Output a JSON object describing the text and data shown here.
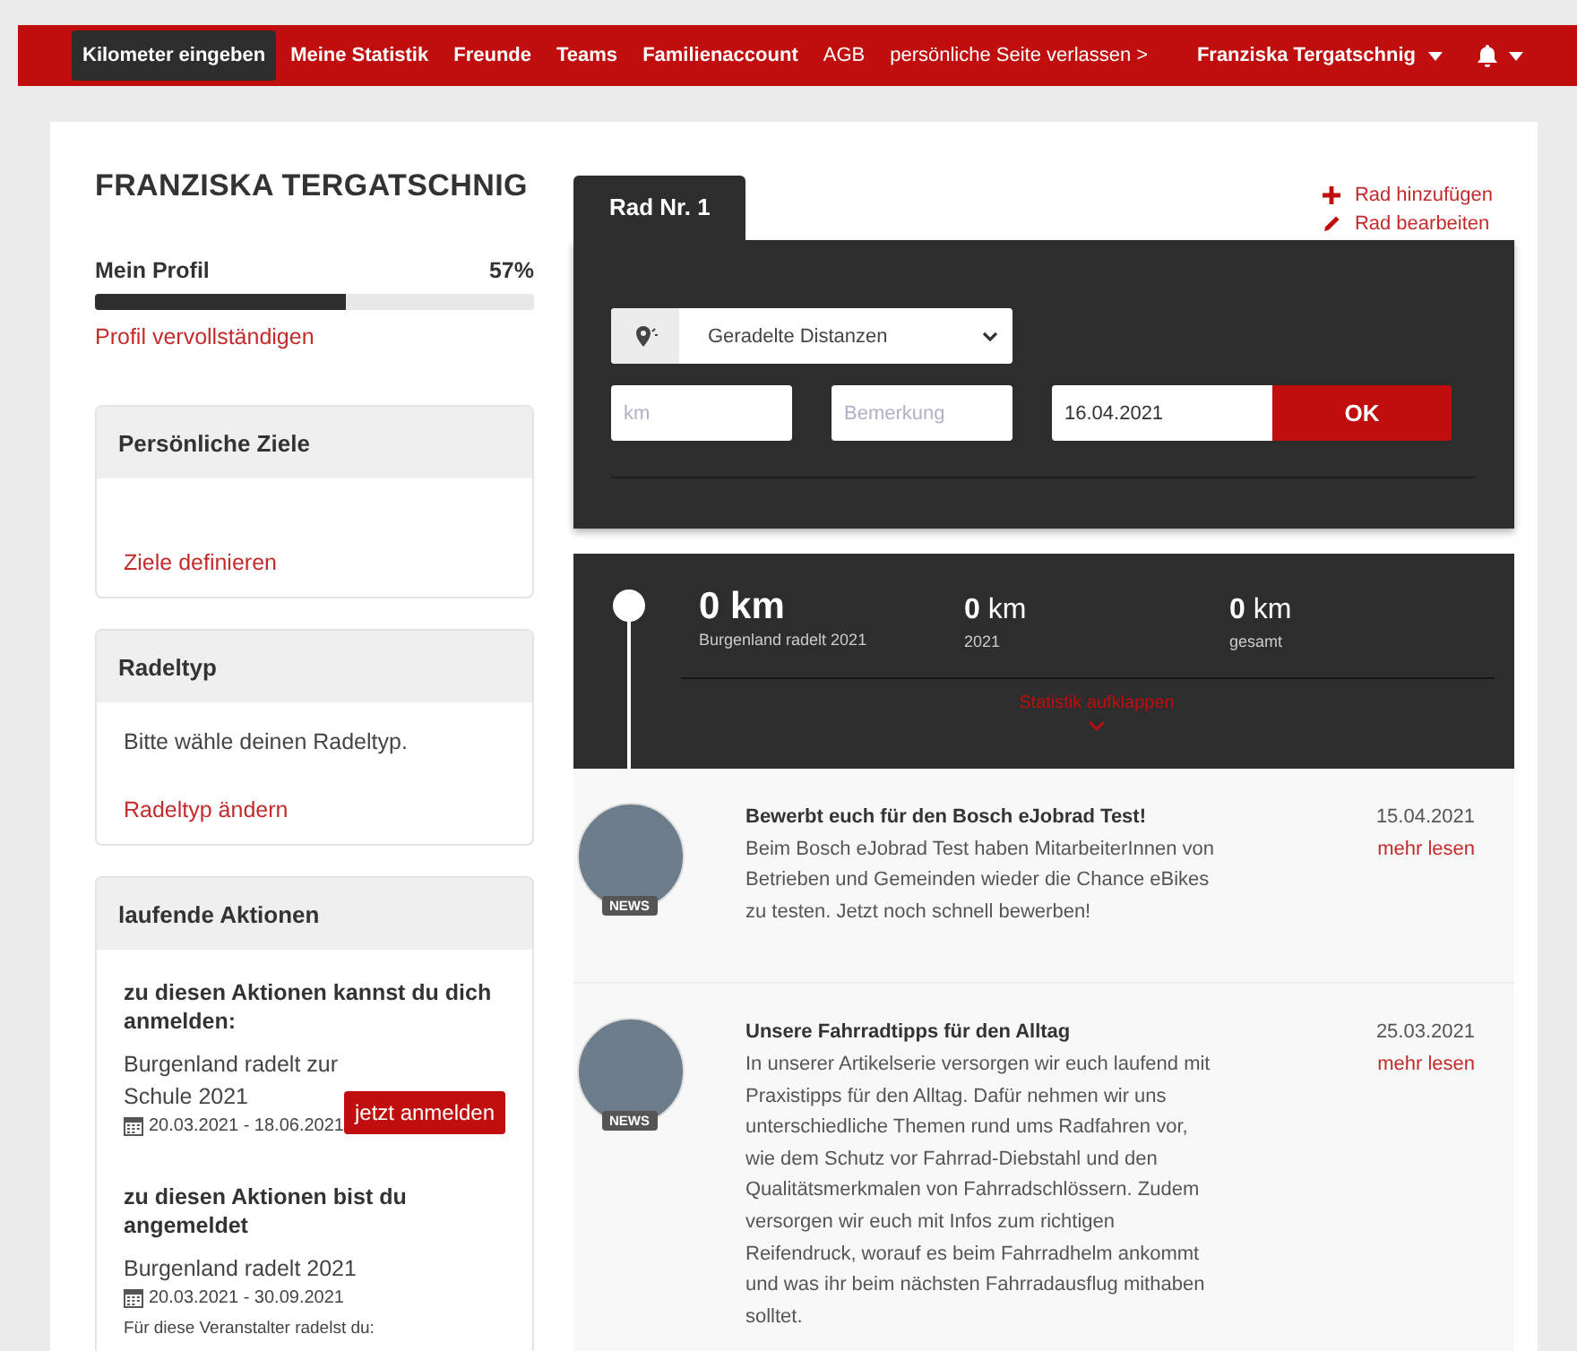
{
  "nav": {
    "items": [
      {
        "label": "Kilometer eingeben",
        "selected": true
      },
      {
        "label": "Meine Statistik",
        "selected": false
      },
      {
        "label": "Freunde",
        "selected": false
      },
      {
        "label": "Teams",
        "selected": false
      },
      {
        "label": "Familienaccount",
        "selected": false
      },
      {
        "label": "AGB",
        "selected": false,
        "kind": "plain"
      },
      {
        "label": "persönliche Seite verlassen >",
        "selected": false,
        "kind": "plain"
      }
    ],
    "user_menu": {
      "label": "Franziska Tergatschnig"
    }
  },
  "profile": {
    "name": "FRANZISKA TERGATSCHNIG",
    "progress_label": "Mein Profil",
    "percent": "57%",
    "level": 0.57,
    "link": "Profil vervollständigen"
  },
  "goals": {
    "title": "Persönliche Ziele",
    "link": "Ziele definieren"
  },
  "rider_type": {
    "title": "Radeltyp",
    "text": "Bitte wähle deinen Radeltyp.",
    "link": "Radeltyp ändern"
  },
  "actions": {
    "title": "laufende Aktionen",
    "sections": [
      {
        "heading": "zu diesen Aktionen kannst du dich anmelden:",
        "events": [
          {
            "name": "Burgenland radelt zur Schule 2021",
            "dates": "20.03.2021 - 18.06.2021",
            "button": "jetzt anmelden"
          }
        ]
      },
      {
        "heading": "zu diesen Aktionen bist du angemeldet",
        "events": [
          {
            "name": "Burgenland radelt 2021",
            "dates": "20.03.2021 - 30.09.2021"
          }
        ],
        "note": "Für diese Veranstalter radelst du:"
      }
    ]
  },
  "bike": {
    "tabs": [
      {
        "label": "Rad Nr. 1",
        "selected": true
      }
    ],
    "links": [
      {
        "label": "Rad hinzufügen",
        "kind": "add"
      },
      {
        "label": "Rad bearbeiten",
        "kind": "edit"
      }
    ],
    "select": {
      "value": "Geradelte Distanzen"
    },
    "km_field": {
      "placeholder": "km"
    },
    "note_field": {
      "placeholder": "Bemerkung"
    },
    "date_field": {
      "value": "16.04.2021"
    },
    "ok_button": "OK"
  },
  "stats": {
    "main": {
      "value": "0 km",
      "caption": "Burgenland radelt 2021"
    },
    "others": [
      {
        "value": "0",
        "unit": "km",
        "caption": "2021"
      },
      {
        "value": "0",
        "unit": "km",
        "caption": "gesamt"
      }
    ],
    "toggle": "Statistik aufklappen"
  },
  "news": [
    {
      "badge": "NEWS",
      "title": "Bewerbt euch für den Bosch eJobrad Test!",
      "text": "Beim Bosch eJobrad Test haben MitarbeiterInnen von Betrieben und Gemeinden wieder die Chance eBikes zu testen. Jetzt noch schnell bewerben!",
      "date": "15.04.2021",
      "link": "mehr lesen"
    },
    {
      "badge": "NEWS",
      "title": "Unsere Fahrradtipps für den Alltag",
      "text": "In unserer Artikelserie versorgen wir euch laufend mit Praxistipps für den Alltag. Dafür nehmen wir uns unterschiedliche Themen rund ums Radfahren vor, wie dem Schutz vor Fahrrad-Diebstahl und den Qualitätsmerkmalen von Fahrradschlössern. Zudem versorgen wir euch mit Infos zum richtigen Reifendruck, worauf es beim Fahrradhelm ankommt und was ihr beim nächsten Fahrradausflug mithaben solltet.",
      "date": "25.03.2021",
      "link": "mehr lesen"
    }
  ]
}
